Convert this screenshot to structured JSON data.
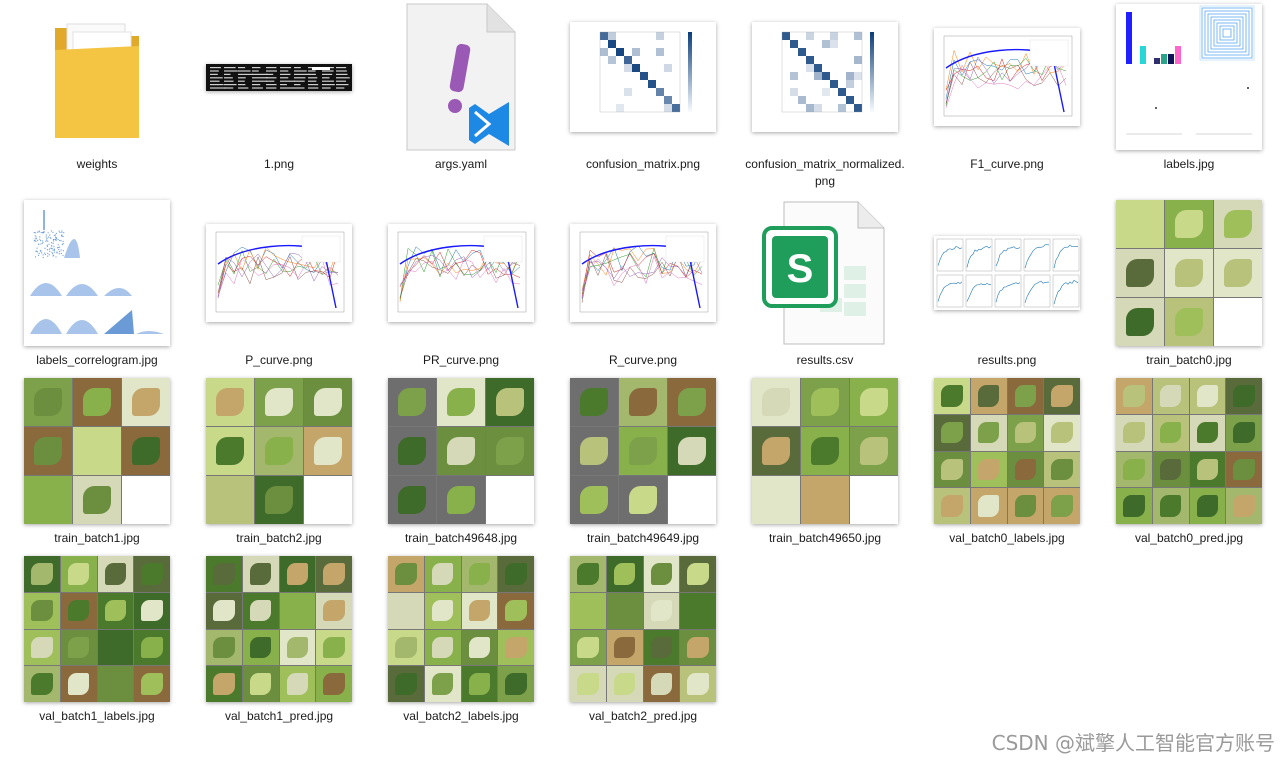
{
  "files": [
    {
      "name": "weights",
      "kind": "folder",
      "icon": "folder-icon"
    },
    {
      "name": "1.png",
      "kind": "terminal",
      "icon": "terminal-screenshot-icon"
    },
    {
      "name": "args.yaml",
      "kind": "yaml",
      "icon": "yaml-file-icon"
    },
    {
      "name": "confusion_matrix.png",
      "kind": "matrix",
      "icon": "confusion-matrix-thumbnail"
    },
    {
      "name": "confusion_matrix_normalized.png",
      "kind": "matrix2",
      "icon": "confusion-matrix-normalized-thumbnail"
    },
    {
      "name": "F1_curve.png",
      "kind": "curve",
      "icon": "f1-curve-thumbnail"
    },
    {
      "name": "labels.jpg",
      "kind": "labels",
      "icon": "labels-thumbnail"
    },
    {
      "name": "labels_correlogram.jpg",
      "kind": "correlogram",
      "icon": "correlogram-thumbnail"
    },
    {
      "name": "P_curve.png",
      "kind": "curve",
      "icon": "p-curve-thumbnail"
    },
    {
      "name": "PR_curve.png",
      "kind": "curve",
      "icon": "pr-curve-thumbnail"
    },
    {
      "name": "R_curve.png",
      "kind": "curve",
      "icon": "r-curve-thumbnail"
    },
    {
      "name": "results.csv",
      "kind": "csv",
      "icon": "csv-file-icon",
      "letter": "S"
    },
    {
      "name": "results.png",
      "kind": "results",
      "icon": "results-thumbnail"
    },
    {
      "name": "train_batch0.jpg",
      "kind": "mosaic",
      "icon": "train-batch-thumbnail"
    },
    {
      "name": "train_batch1.jpg",
      "kind": "mosaic",
      "icon": "train-batch-thumbnail"
    },
    {
      "name": "train_batch2.jpg",
      "kind": "mosaic",
      "icon": "train-batch-thumbnail"
    },
    {
      "name": "train_batch49648.jpg",
      "kind": "mosaic-grey",
      "icon": "train-batch-thumbnail"
    },
    {
      "name": "train_batch49649.jpg",
      "kind": "mosaic-grey",
      "icon": "train-batch-thumbnail"
    },
    {
      "name": "train_batch49650.jpg",
      "kind": "mosaic",
      "icon": "train-batch-thumbnail"
    },
    {
      "name": "val_batch0_labels.jpg",
      "kind": "val",
      "icon": "val-batch-thumbnail"
    },
    {
      "name": "val_batch0_pred.jpg",
      "kind": "val",
      "icon": "val-batch-thumbnail"
    },
    {
      "name": "val_batch1_labels.jpg",
      "kind": "val",
      "icon": "val-batch-thumbnail"
    },
    {
      "name": "val_batch1_pred.jpg",
      "kind": "val",
      "icon": "val-batch-thumbnail"
    },
    {
      "name": "val_batch2_labels.jpg",
      "kind": "val",
      "icon": "val-batch-thumbnail"
    },
    {
      "name": "val_batch2_pred.jpg",
      "kind": "val",
      "icon": "val-batch-thumbnail"
    }
  ],
  "colors": {
    "folder": "#f4c542",
    "folder_dark": "#e0a92a",
    "yaml_mark": "#9b59b6",
    "vscode_blue": "#1e88e5",
    "csv_green": "#1e9e5a",
    "matrix_dark": "#0b3d7a",
    "leaf_green": "#5f8f3a"
  },
  "watermark": "CSDN @斌擎人工智能官方账号"
}
